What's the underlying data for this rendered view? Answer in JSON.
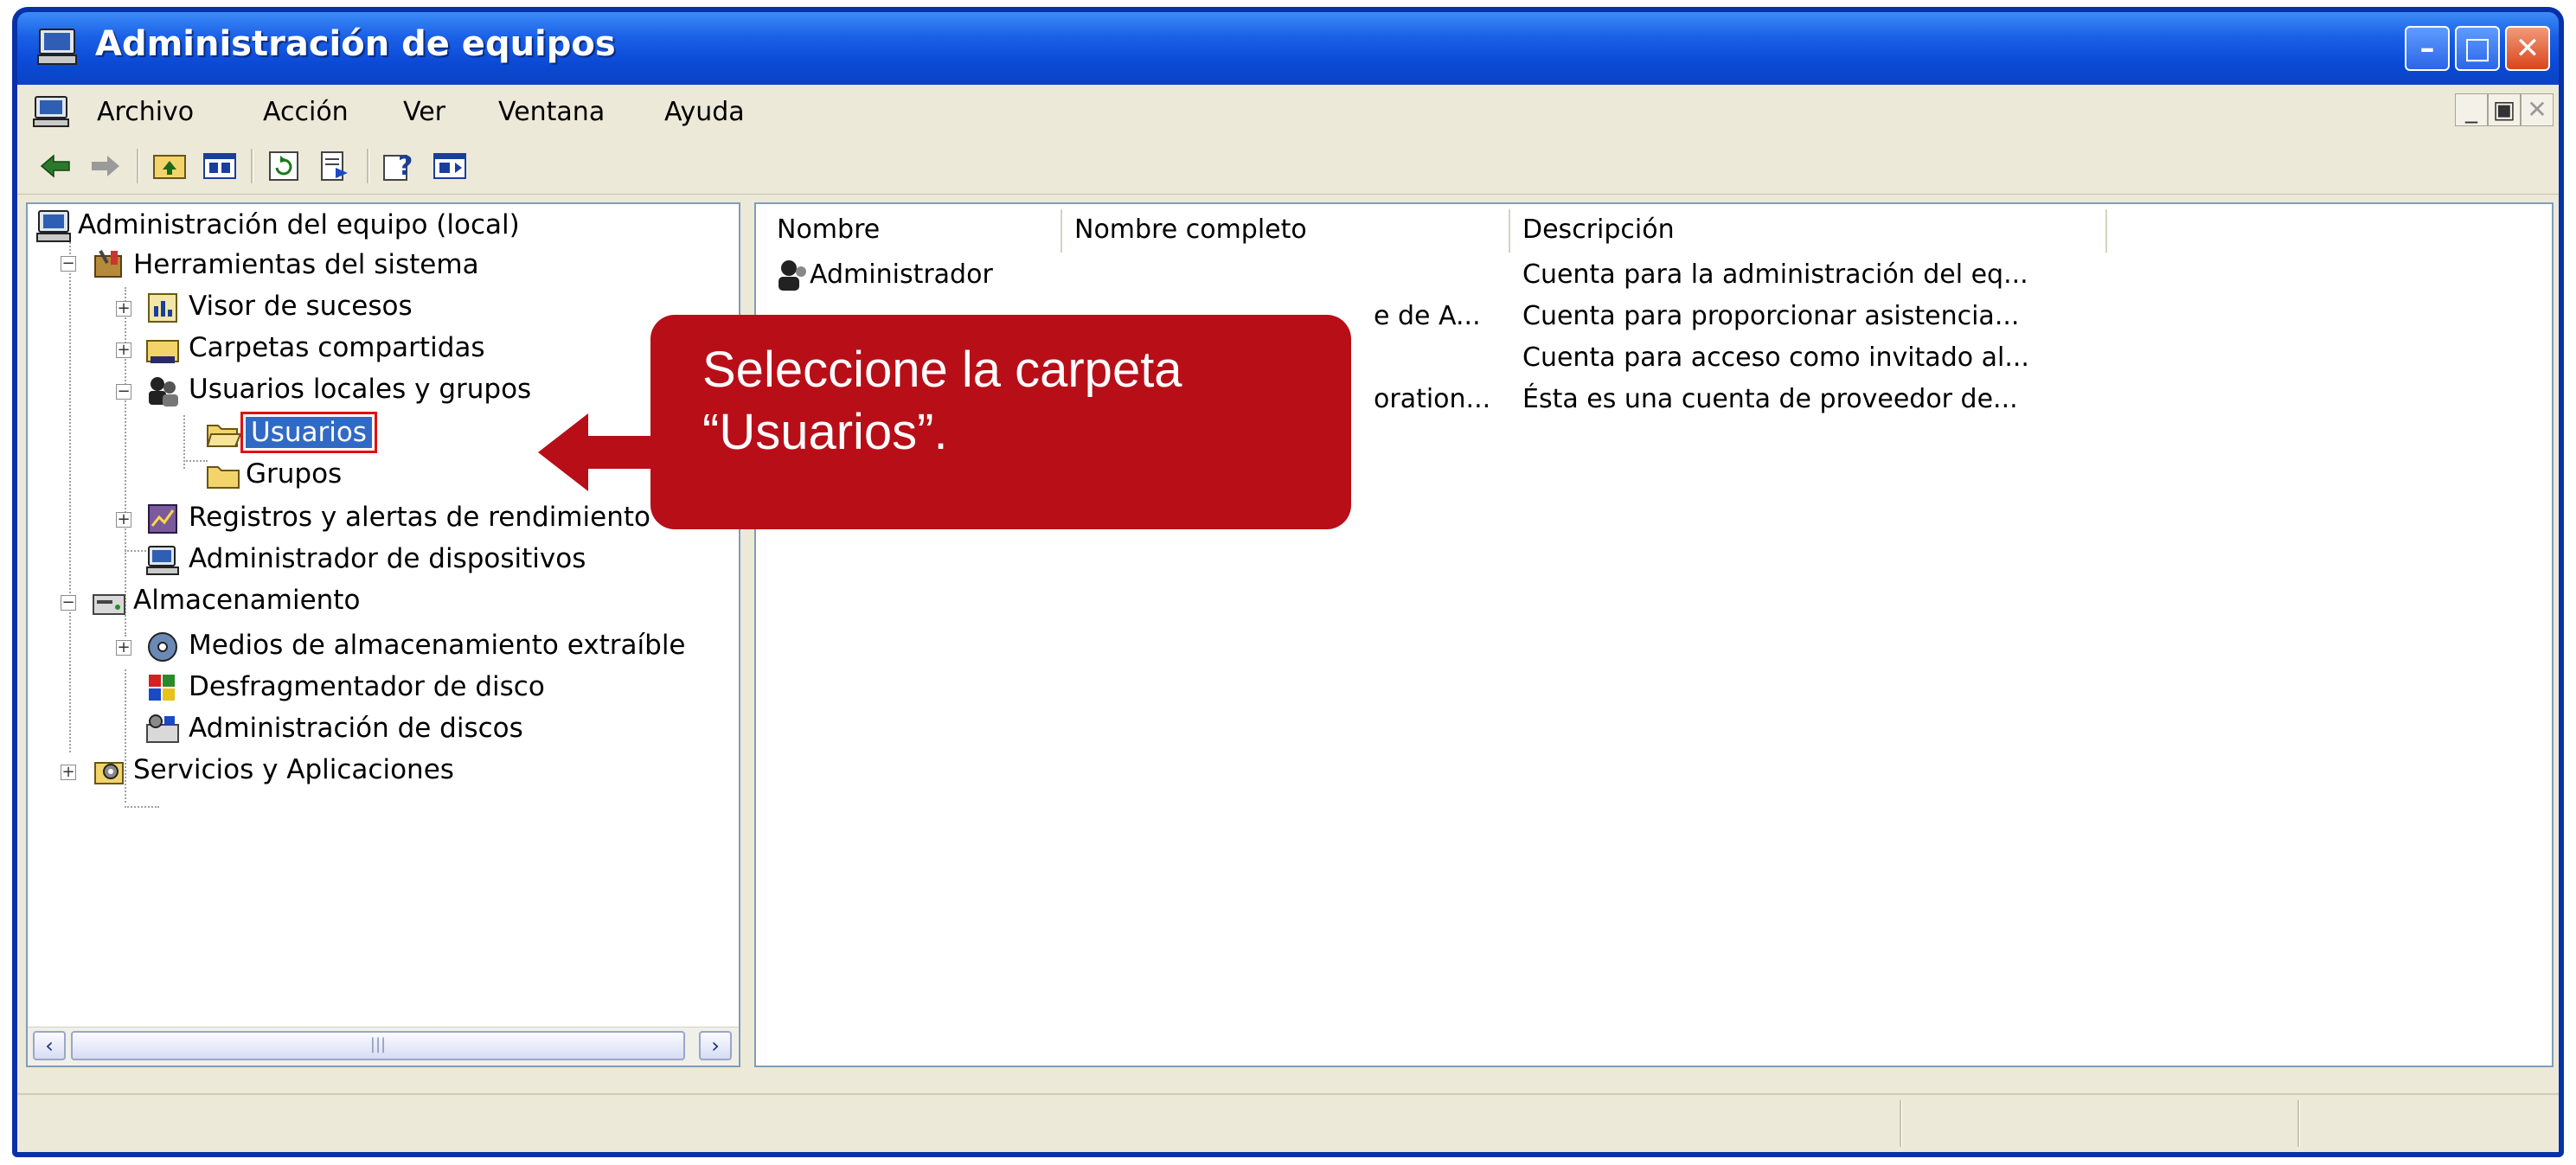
{
  "window": {
    "title": "Administración de equipos",
    "controls": [
      "minimize",
      "maximize",
      "close"
    ]
  },
  "menu": {
    "items": [
      "Archivo",
      "Acción",
      "Ver",
      "Ventana",
      "Ayuda"
    ],
    "mdi_controls": [
      "minimize",
      "restore",
      "close"
    ]
  },
  "toolbar": {
    "icons": [
      "back-arrow-icon",
      "forward-arrow-icon",
      "up-folder-icon",
      "show-hide-tree-icon",
      "refresh-icon",
      "export-list-icon",
      "help-icon",
      "show-hide-action-pane-icon"
    ]
  },
  "tree": {
    "root": "Administración del equipo (local)",
    "system_tools": "Herramientas del sistema",
    "event_viewer": "Visor de sucesos",
    "shared_folders": "Carpetas compartidas",
    "local_users_groups": "Usuarios locales y grupos",
    "users": "Usuarios",
    "groups": "Grupos",
    "performance_logs": "Registros y alertas de rendimiento",
    "device_manager": "Administrador de dispositivos",
    "storage": "Almacenamiento",
    "removable_storage": "Medios de almacenamiento extraíble",
    "defragmenter": "Desfragmentador de disco",
    "disk_management": "Administración de discos",
    "services_apps": "Servicios y Aplicaciones"
  },
  "list": {
    "columns": [
      "Nombre",
      "Nombre completo",
      "Descripción"
    ],
    "rows": [
      {
        "name": "Administrador",
        "full_name": "",
        "description": "Cuenta para la administración del eq..."
      },
      {
        "name": "",
        "full_name": "e de A...",
        "description": "Cuenta para proporcionar asistencia..."
      },
      {
        "name": "",
        "full_name": "",
        "description": "Cuenta para acceso como invitado al..."
      },
      {
        "name": "",
        "full_name": "oration...",
        "description": "Ésta es una cuenta de proveedor de..."
      }
    ]
  },
  "callout": {
    "line1": "Seleccione la carpeta",
    "line2": "“Usuarios”."
  },
  "colors": {
    "titlebar": "#0b4ad6",
    "callout": "#b80e18",
    "selection": "#316ac5",
    "highlight_outline": "#e01010"
  }
}
